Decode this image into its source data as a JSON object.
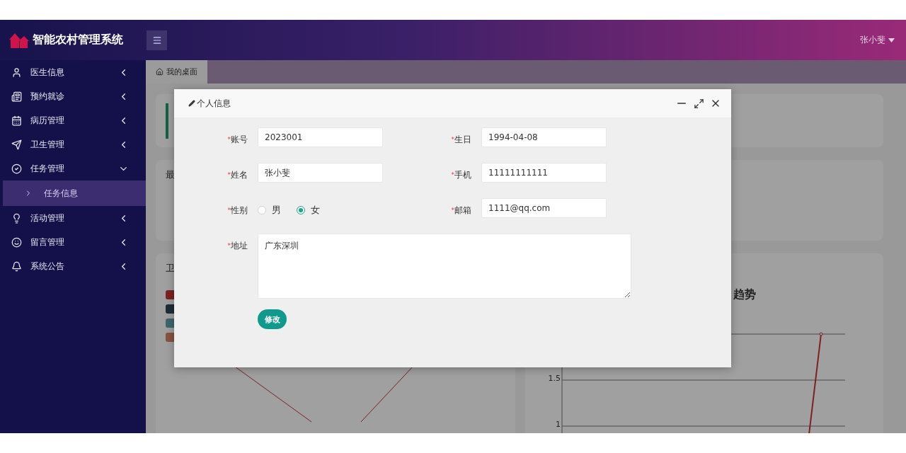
{
  "header": {
    "app_title": "智能农村管理系统",
    "user": "张小斐"
  },
  "sidebar": {
    "items": [
      {
        "label": "医生信息",
        "expanded": false
      },
      {
        "label": "预约就诊",
        "expanded": false
      },
      {
        "label": "病历管理",
        "expanded": false
      },
      {
        "label": "卫生管理",
        "expanded": false
      },
      {
        "label": "任务管理",
        "expanded": true,
        "children": [
          {
            "label": "任务信息",
            "selected": true
          }
        ]
      },
      {
        "label": "活动管理",
        "expanded": false
      },
      {
        "label": "留言管理",
        "expanded": false
      },
      {
        "label": "系统公告",
        "expanded": false
      }
    ]
  },
  "tabs": [
    {
      "label": "我的桌面",
      "selected": true
    }
  ],
  "dashboard": {
    "card_titles": [
      "最",
      "卫"
    ],
    "legend": [
      {
        "color": "#7c221f"
      },
      {
        "color": "#1e2c36"
      },
      {
        "color": "#3e666c"
      },
      {
        "color": "#885341"
      }
    ],
    "trend_chart": {
      "title": "趋势",
      "y_tick_labels": [
        "1.5",
        "1"
      ]
    }
  },
  "dialog": {
    "title": "个人信息",
    "fields": [
      {
        "kind": "text",
        "required_mark": "*",
        "label": "账号",
        "value": "2023001"
      },
      {
        "kind": "text",
        "required_mark": "*",
        "label": "生日",
        "value": "1994-04-08"
      },
      {
        "kind": "text",
        "required_mark": "*",
        "label": "姓名",
        "value": "张小斐"
      },
      {
        "kind": "text",
        "required_mark": "*",
        "label": "手机",
        "value": "11111111111"
      },
      {
        "kind": "radio",
        "required_mark": "*",
        "label": "性别",
        "options": [
          {
            "label": "男",
            "selected": false
          },
          {
            "label": "女",
            "selected": true
          }
        ]
      },
      {
        "kind": "text",
        "required_mark": "*",
        "label": "邮箱",
        "value": "1111@qq.com"
      },
      {
        "kind": "textarea",
        "required_mark": "*",
        "label": "地址",
        "value": "广东深圳"
      }
    ],
    "submit": "修改"
  }
}
